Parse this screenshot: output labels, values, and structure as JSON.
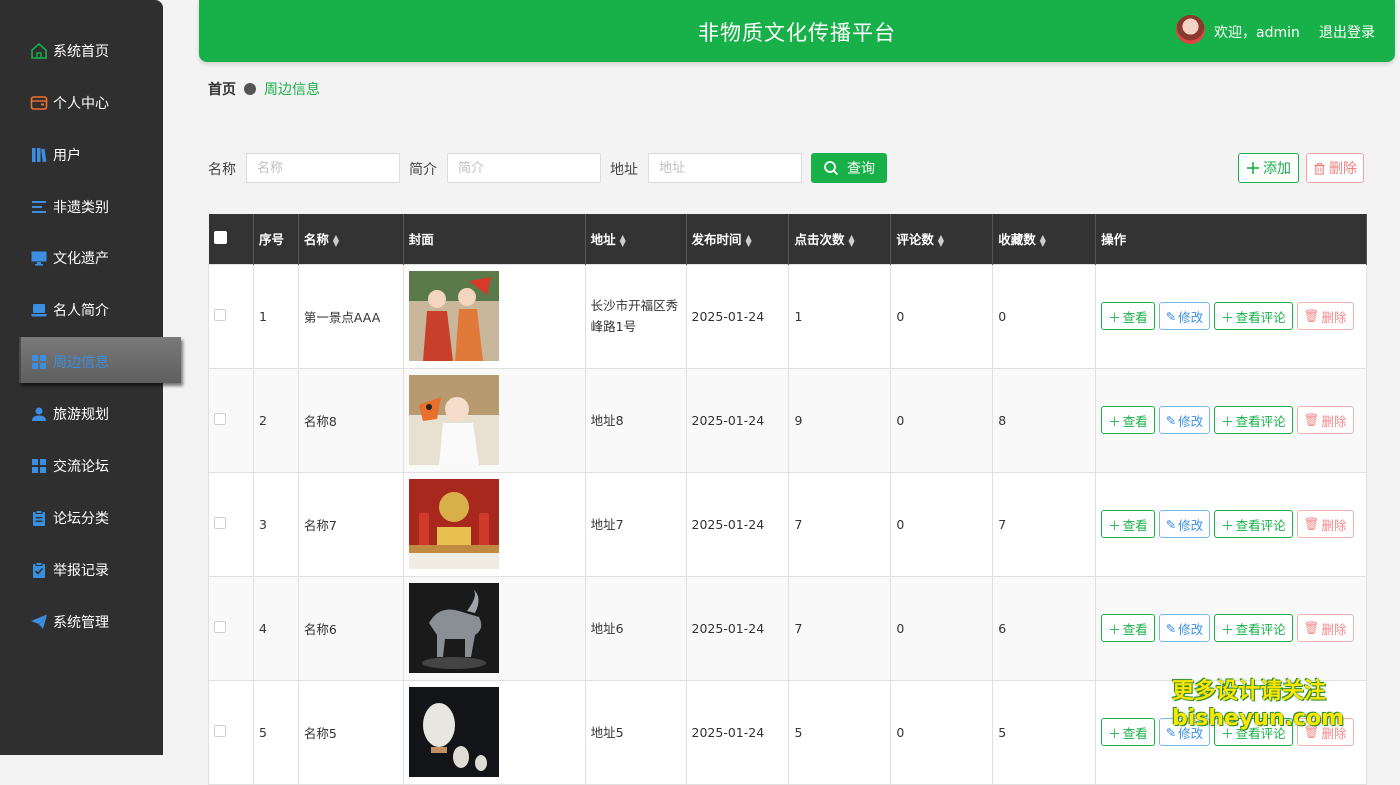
{
  "sidebar": {
    "items": [
      {
        "label": "系统首页",
        "icon": "home-icon"
      },
      {
        "label": "个人中心",
        "icon": "wallet-icon"
      },
      {
        "label": "用户",
        "icon": "books-icon"
      },
      {
        "label": "非遗类别",
        "icon": "list-icon"
      },
      {
        "label": "文化遗产",
        "icon": "monitor-icon"
      },
      {
        "label": "名人简介",
        "icon": "laptop-icon"
      },
      {
        "label": "周边信息",
        "icon": "grid-icon"
      },
      {
        "label": "旅游规划",
        "icon": "user-icon"
      },
      {
        "label": "交流论坛",
        "icon": "grid-icon"
      },
      {
        "label": "论坛分类",
        "icon": "clipboard-icon"
      },
      {
        "label": "举报记录",
        "icon": "clipboard-check-icon"
      },
      {
        "label": "系统管理",
        "icon": "send-icon"
      }
    ],
    "active_index": 6
  },
  "header": {
    "title": "非物质文化传播平台",
    "welcome": "欢迎，admin",
    "logout": "退出登录"
  },
  "breadcrumb": {
    "home": "首页",
    "current": "周边信息"
  },
  "search": {
    "name_label": "名称",
    "name_placeholder": "名称",
    "intro_label": "简介",
    "intro_placeholder": "简介",
    "address_label": "地址",
    "address_placeholder": "地址",
    "query_button": "查询"
  },
  "actions": {
    "add": "添加",
    "delete": "删除"
  },
  "table": {
    "columns": [
      "序号",
      "名称",
      "封面",
      "地址",
      "发布时间",
      "点击次数",
      "评论数",
      "收藏数",
      "操作"
    ],
    "rows": [
      {
        "no": "1",
        "name": "第一景点AAA",
        "address": "长沙市开福区秀峰路1号",
        "time": "2025-01-24",
        "clicks": "1",
        "comments": "0",
        "favorites": "0"
      },
      {
        "no": "2",
        "name": "名称8",
        "address": "地址8",
        "time": "2025-01-24",
        "clicks": "9",
        "comments": "0",
        "favorites": "8"
      },
      {
        "no": "3",
        "name": "名称7",
        "address": "地址7",
        "time": "2025-01-24",
        "clicks": "7",
        "comments": "0",
        "favorites": "7"
      },
      {
        "no": "4",
        "name": "名称6",
        "address": "地址6",
        "time": "2025-01-24",
        "clicks": "7",
        "comments": "0",
        "favorites": "6"
      },
      {
        "no": "5",
        "name": "名称5",
        "address": "地址5",
        "time": "2025-01-24",
        "clicks": "5",
        "comments": "0",
        "favorites": "5"
      }
    ],
    "row_actions": {
      "view": "查看",
      "edit": "修改",
      "view_comments": "查看评论",
      "delete": "删除"
    }
  },
  "watermark": {
    "line1": "更多设计请关注",
    "line2": "bisheyun.com"
  },
  "colors": {
    "primary": "#18b048",
    "sidebar_bg": "#2f2f2f",
    "table_header_bg": "#333333",
    "edit_blue": "#3b8fe0",
    "delete_red": "#f08080"
  }
}
